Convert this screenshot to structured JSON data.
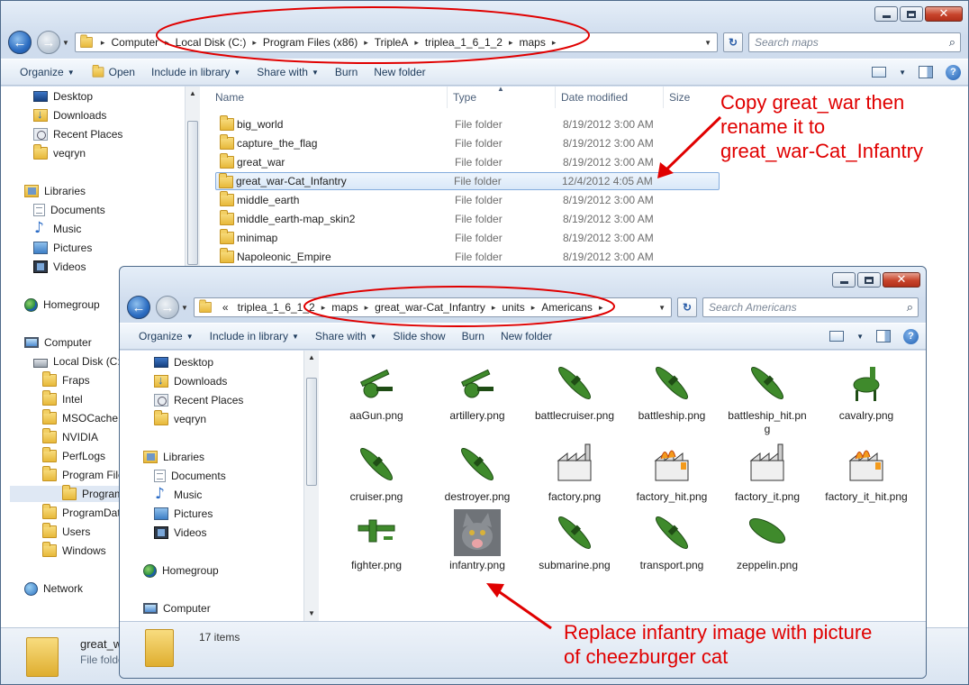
{
  "colors": {
    "annotation": "#e00000",
    "selection": "#d9e8f8",
    "folder": "#e7b83a"
  },
  "back_window": {
    "breadcrumbs": [
      "Computer",
      "Local Disk (C:)",
      "Program Files (x86)",
      "TripleA",
      "triplea_1_6_1_2",
      "maps"
    ],
    "search_placeholder": "Search maps",
    "toolbar": {
      "organize": "Organize",
      "open": "Open",
      "include": "Include in library",
      "share": "Share with",
      "burn": "Burn",
      "new_folder": "New folder"
    },
    "columns": {
      "name": "Name",
      "type": "Type",
      "date": "Date modified",
      "size": "Size"
    },
    "nav": [
      {
        "label": "Desktop",
        "icon": "desktop-icon"
      },
      {
        "label": "Downloads",
        "icon": "downloads-icon"
      },
      {
        "label": "Recent Places",
        "icon": "recent-icon"
      },
      {
        "label": "veqryn",
        "icon": "folder-icon"
      },
      {
        "label": "Libraries",
        "icon": "libraries-icon"
      },
      {
        "label": "Documents",
        "icon": "documents-icon"
      },
      {
        "label": "Music",
        "icon": "music-icon"
      },
      {
        "label": "Pictures",
        "icon": "pictures-icon"
      },
      {
        "label": "Videos",
        "icon": "videos-icon"
      },
      {
        "label": "Homegroup",
        "icon": "homegroup-icon"
      },
      {
        "label": "Computer",
        "icon": "computer-icon"
      },
      {
        "label": "Local Disk (C:)",
        "icon": "disk-icon"
      },
      {
        "label": "Fraps",
        "icon": "folder-icon"
      },
      {
        "label": "Intel",
        "icon": "folder-icon"
      },
      {
        "label": "MSOCache",
        "icon": "folder-icon"
      },
      {
        "label": "NVIDIA",
        "icon": "folder-icon"
      },
      {
        "label": "PerfLogs",
        "icon": "folder-icon"
      },
      {
        "label": "Program Files",
        "icon": "folder-icon"
      },
      {
        "label": "Program Files (x86)",
        "icon": "folder-icon"
      },
      {
        "label": "ProgramData",
        "icon": "folder-icon"
      },
      {
        "label": "Users",
        "icon": "folder-icon"
      },
      {
        "label": "Windows",
        "icon": "folder-icon"
      },
      {
        "label": "Network",
        "icon": "network-icon"
      }
    ],
    "files": [
      {
        "name": "big_world",
        "type": "File folder",
        "date": "8/19/2012 3:00 AM"
      },
      {
        "name": "capture_the_flag",
        "type": "File folder",
        "date": "8/19/2012 3:00 AM"
      },
      {
        "name": "great_war",
        "type": "File folder",
        "date": "8/19/2012 3:00 AM"
      },
      {
        "name": "great_war-Cat_Infantry",
        "type": "File folder",
        "date": "12/4/2012 4:05 AM"
      },
      {
        "name": "middle_earth",
        "type": "File folder",
        "date": "8/19/2012 3:00 AM"
      },
      {
        "name": "middle_earth-map_skin2",
        "type": "File folder",
        "date": "8/19/2012 3:00 AM"
      },
      {
        "name": "minimap",
        "type": "File folder",
        "date": "8/19/2012 3:00 AM"
      },
      {
        "name": "Napoleonic_Empire",
        "type": "File folder",
        "date": "8/19/2012 3:00 AM"
      }
    ],
    "status": {
      "name": "great_w",
      "type": "File folde"
    }
  },
  "front_window": {
    "breadcrumb_prefix": "«",
    "breadcrumbs": [
      "triplea_1_6_1_2",
      "maps",
      "great_war-Cat_Infantry",
      "units",
      "Americans"
    ],
    "search_placeholder": "Search Americans",
    "toolbar": {
      "organize": "Organize",
      "include": "Include in library",
      "share": "Share with",
      "slideshow": "Slide show",
      "burn": "Burn",
      "new_folder": "New folder"
    },
    "nav": [
      {
        "label": "Desktop",
        "icon": "desktop-icon"
      },
      {
        "label": "Downloads",
        "icon": "downloads-icon"
      },
      {
        "label": "Recent Places",
        "icon": "recent-icon"
      },
      {
        "label": "veqryn",
        "icon": "folder-icon"
      },
      {
        "label": "Libraries",
        "icon": "libraries-icon"
      },
      {
        "label": "Documents",
        "icon": "documents-icon"
      },
      {
        "label": "Music",
        "icon": "music-icon"
      },
      {
        "label": "Pictures",
        "icon": "pictures-icon"
      },
      {
        "label": "Videos",
        "icon": "videos-icon"
      },
      {
        "label": "Homegroup",
        "icon": "homegroup-icon"
      },
      {
        "label": "Computer",
        "icon": "computer-icon"
      }
    ],
    "files": [
      {
        "name": "aaGun.png",
        "icon": "aa-gun-icon"
      },
      {
        "name": "artillery.png",
        "icon": "artillery-icon"
      },
      {
        "name": "battlecruiser.png",
        "icon": "battlecruiser-icon"
      },
      {
        "name": "battleship.png",
        "icon": "battleship-icon"
      },
      {
        "name": "battleship_hit.png",
        "icon": "battleship-hit-icon"
      },
      {
        "name": "cavalry.png",
        "icon": "cavalry-icon"
      },
      {
        "name": "cruiser.png",
        "icon": "cruiser-icon"
      },
      {
        "name": "destroyer.png",
        "icon": "destroyer-icon"
      },
      {
        "name": "factory.png",
        "icon": "factory-icon"
      },
      {
        "name": "factory_hit.png",
        "icon": "factory-hit-icon"
      },
      {
        "name": "factory_it.png",
        "icon": "factory-it-icon"
      },
      {
        "name": "factory_it_hit.png",
        "icon": "factory-it-hit-icon"
      },
      {
        "name": "fighter.png",
        "icon": "fighter-icon"
      },
      {
        "name": "infantry.png",
        "icon": "cat-photo-icon"
      },
      {
        "name": "submarine.png",
        "icon": "submarine-icon"
      },
      {
        "name": "transport.png",
        "icon": "transport-icon"
      },
      {
        "name": "zeppelin.png",
        "icon": "zeppelin-icon"
      }
    ],
    "status": {
      "count": "17 items"
    }
  },
  "annotations": {
    "copy_lines": [
      "Copy great_war then",
      "rename it to",
      "great_war-Cat_Infantry"
    ],
    "replace_lines": [
      "Replace infantry image with picture",
      "of cheezburger cat"
    ]
  }
}
